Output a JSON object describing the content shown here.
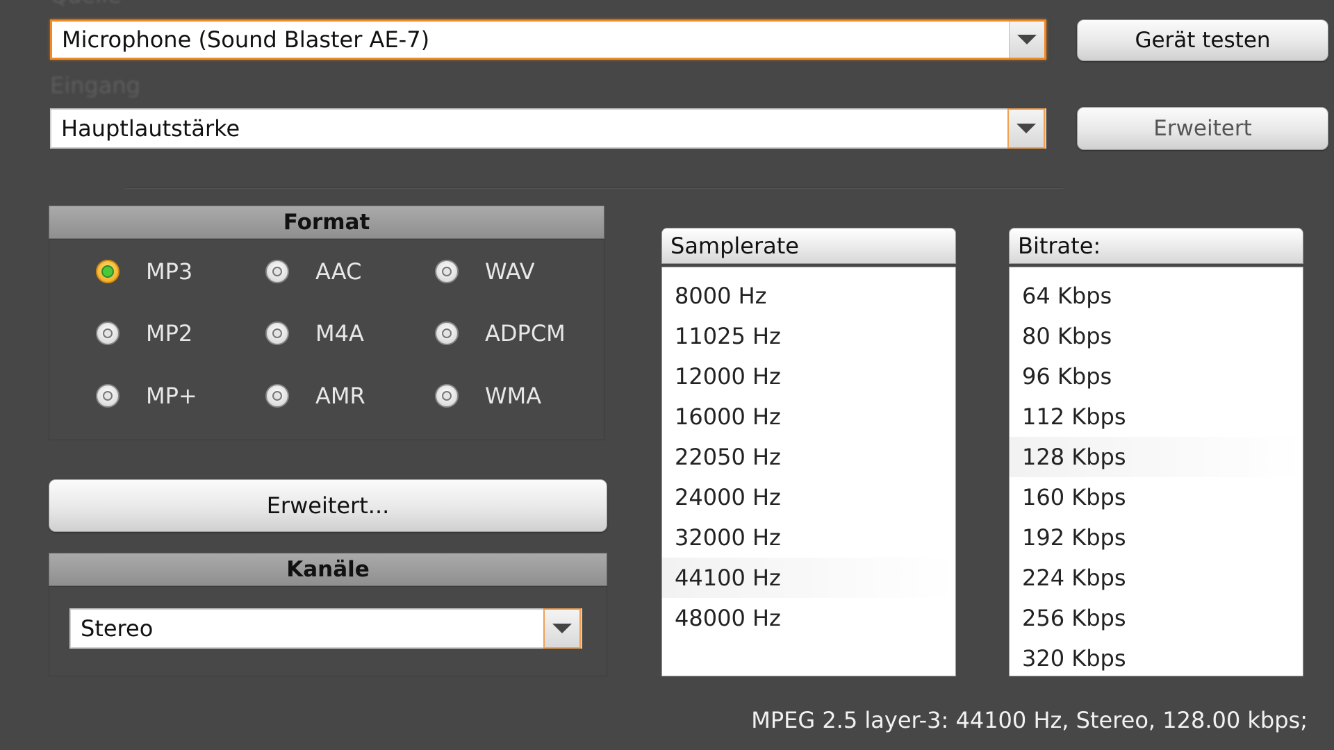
{
  "labels": {
    "source_label_cut": "Quelle",
    "input_label_cut": "Eingang"
  },
  "device": {
    "value": "Microphone (Sound Blaster AE-7)",
    "test_button": "Gerät testen"
  },
  "input": {
    "value": "Hauptlautstärke",
    "advanced_button": "Erweitert"
  },
  "format": {
    "header": "Format",
    "options": [
      {
        "label": "MP3",
        "checked": true
      },
      {
        "label": "AAC",
        "checked": false
      },
      {
        "label": "WAV",
        "checked": false
      },
      {
        "label": "MP2",
        "checked": false
      },
      {
        "label": "M4A",
        "checked": false
      },
      {
        "label": "ADPCM",
        "checked": false
      },
      {
        "label": "MP+",
        "checked": false
      },
      {
        "label": "AMR",
        "checked": false
      },
      {
        "label": "WMA",
        "checked": false
      }
    ],
    "advanced_button": "Erweitert..."
  },
  "channels": {
    "header": "Kanäle",
    "value": "Stereo"
  },
  "samplerate": {
    "header": "Samplerate",
    "items": [
      "8000 Hz",
      "11025 Hz",
      "12000 Hz",
      "16000 Hz",
      "22050 Hz",
      "24000 Hz",
      "32000 Hz",
      "44100 Hz",
      "48000 Hz"
    ],
    "selected": "44100 Hz"
  },
  "bitrate": {
    "header": "Bitrate:",
    "items": [
      "64 Kbps",
      "80 Kbps",
      "96 Kbps",
      "112 Kbps",
      "128 Kbps",
      "160 Kbps",
      "192 Kbps",
      "224 Kbps",
      "256 Kbps",
      "320 Kbps"
    ],
    "selected": "128 Kbps"
  },
  "status": {
    "text": "MPEG 2.5 layer-3: 44100 Hz,  Stereo, 128.00 kbps;"
  },
  "colors": {
    "background": "#474747",
    "focus_accent": "#f08a24",
    "radio_checked": "#4cc83a"
  }
}
